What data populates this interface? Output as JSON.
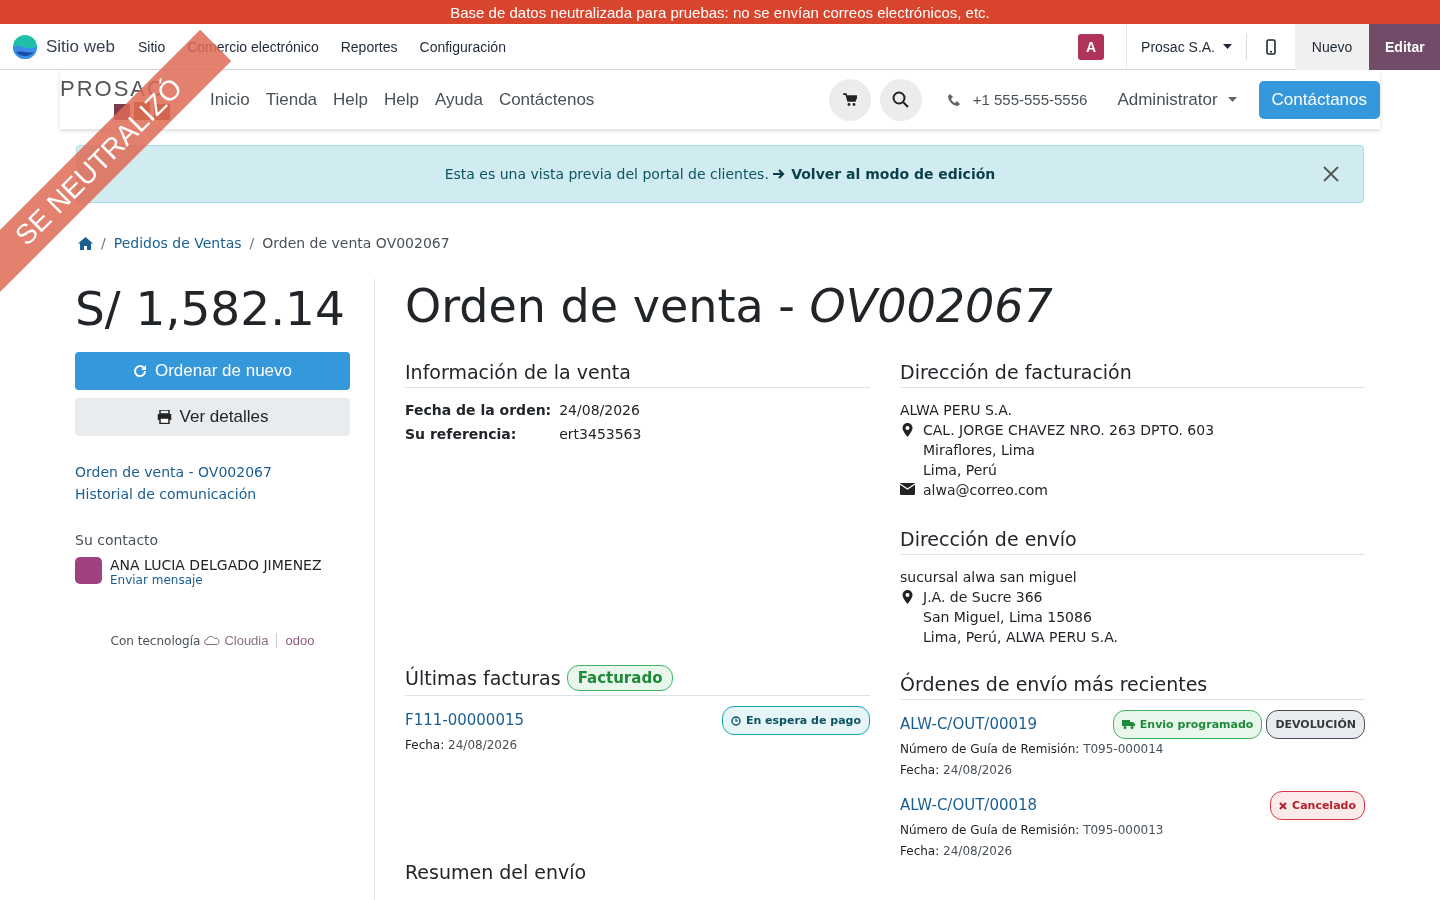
{
  "notice_bar": "Base de datos neutralizada para pruebas: no se envían correos electrónicos, etc.",
  "ribbon": "SE NEUTRALIZÓ",
  "navbar": {
    "app": "Sitio web",
    "menus": [
      "Sitio",
      "Comercio electrónico",
      "Reportes",
      "Configuración"
    ],
    "avatar": "A",
    "company": "Prosac S.A.",
    "buttons": [
      {
        "label": "Nuevo",
        "kind": "light"
      },
      {
        "label": "Editar",
        "kind": "primary"
      }
    ]
  },
  "site_header": {
    "logo": "PROSAC",
    "menu": [
      "Inicio",
      "Tienda",
      "Help",
      "Help",
      "Ayuda",
      "Contáctenos"
    ],
    "phone": "+1 555-555-5556",
    "user": "Administrator",
    "cta": "Contáctanos"
  },
  "alert": {
    "text": "Esta es una vista previa del portal de clientes.",
    "link": "Volver al modo de edición"
  },
  "breadcrumb_separator": "/",
  "breadcrumb": [
    {
      "label": "Pedidos de Ventas",
      "current": false
    },
    {
      "label": "Orden de venta OV002067",
      "current": true
    }
  ],
  "sidebar": {
    "amount": "S/ 1,582.14",
    "reorder": "Ordenar de nuevo",
    "details": "Ver detalles",
    "links": [
      "Orden de venta - OV002067",
      "Historial de comunicación"
    ],
    "contact_label": "Su contacto",
    "contact_name": "ANA LUCIA DELGADO JIMENEZ",
    "contact_action": "Enviar mensaje",
    "powered": "Con tecnología",
    "brands": [
      "Cloudia",
      "odoo"
    ]
  },
  "title": "Orden de venta - *OV002067*",
  "sale_info": {
    "heading": "Información de la venta",
    "fields": [
      {
        "label": "Fecha de la orden:",
        "value": "24/08/2026"
      },
      {
        "label": "Su referencia:",
        "value": "ert3453563"
      }
    ]
  },
  "billing": {
    "heading": "Dirección de facturación",
    "name": "ALWA PERU S.A.",
    "address": [
      "CAL. JORGE CHAVEZ NRO. 263 DPTO. 603",
      "Miraflores, Lima",
      "Lima, Perú"
    ],
    "email": "alwa@correo.com"
  },
  "shipping": {
    "heading": "Dirección de envío",
    "name": "sucursal alwa san miguel",
    "address": [
      "J.A. de Sucre 366",
      "San Miguel, Lima 15086",
      "Lima, Perú, ALWA PERU S.A."
    ]
  },
  "invoices": {
    "heading": "Últimas facturas",
    "status": {
      "label": "Facturado",
      "kind": "success"
    },
    "items": [
      {
        "number": "F111-00000015",
        "date_label": "Fecha:",
        "date": "24/08/2026",
        "badges": [
          {
            "label": "En espera de pago",
            "kind": "info"
          }
        ]
      }
    ]
  },
  "deliveries": {
    "heading": "Órdenes de envío más recientes",
    "items": [
      {
        "number": "ALW-C/OUT/00019",
        "guide_label": "Número de Guía de Remisión:",
        "guide": "T095-000014",
        "date_label": "Fecha:",
        "date": "24/08/2026",
        "badges": [
          {
            "label": "Envio programado",
            "kind": "success"
          },
          {
            "label": "DEVOLUCIÓN",
            "kind": "neutral"
          }
        ]
      },
      {
        "number": "ALW-C/OUT/00018",
        "guide_label": "Número de Guía de Remisión:",
        "guide": "T095-000013",
        "date_label": "Fecha:",
        "date": "24/08/2026",
        "badges": [
          {
            "label": "Cancelado",
            "kind": "danger"
          }
        ]
      }
    ]
  },
  "summary_heading": "Resumen del envío"
}
